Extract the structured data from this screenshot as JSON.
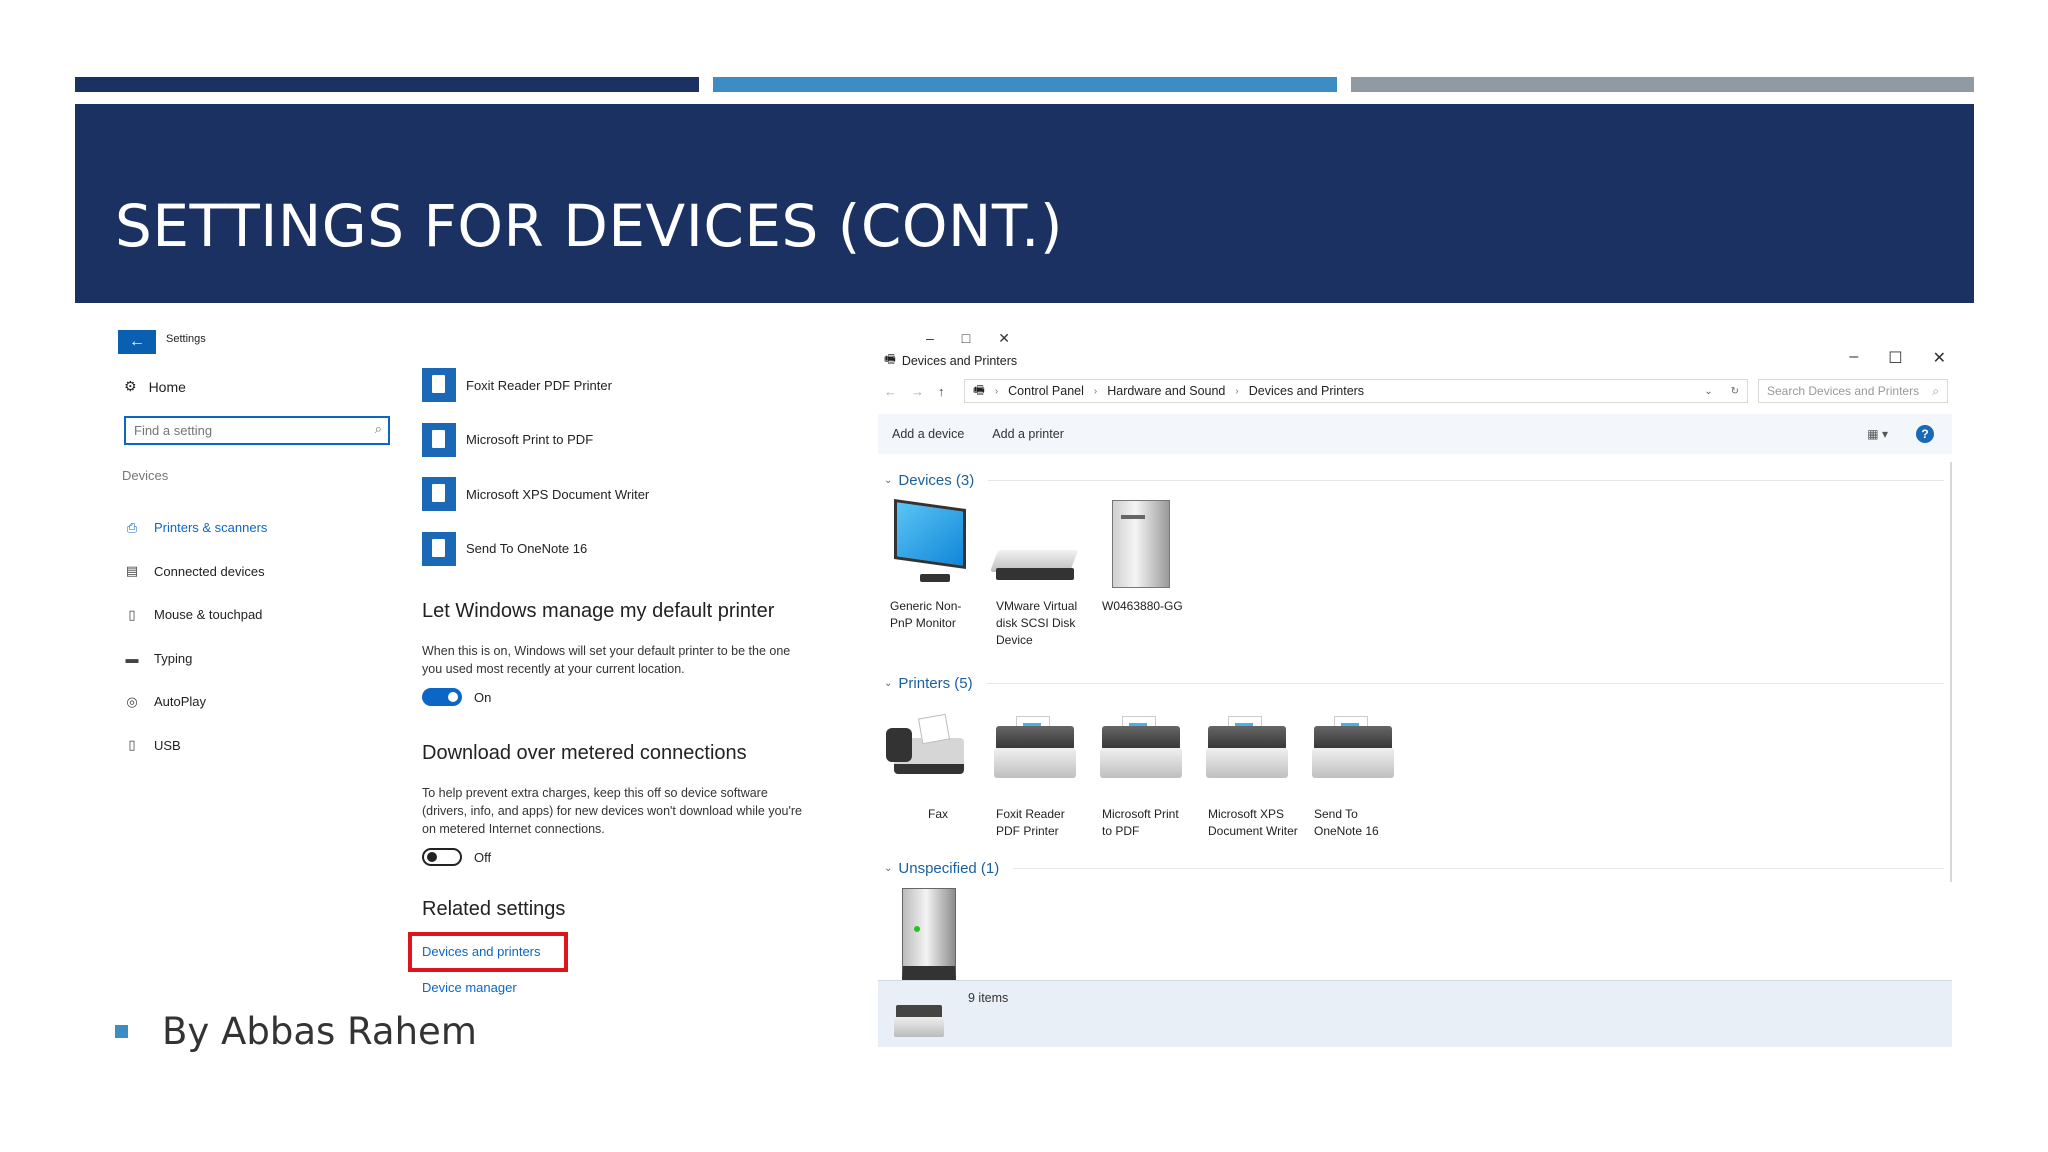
{
  "slide": {
    "title": "SETTINGS FOR DEVICES (CONT.)",
    "byline": "By Abbas Rahem",
    "colors": {
      "navy": "#1b3162",
      "blue": "#3d8cc4",
      "gray": "#8f9aa3",
      "highlight": "#e0141b"
    }
  },
  "settings": {
    "window_title": "Settings",
    "home_label": "Home",
    "search_placeholder": "Find a setting",
    "section_label": "Devices",
    "nav": [
      {
        "label": "Printers & scanners",
        "icon": "printer-icon",
        "active": true
      },
      {
        "label": "Connected devices",
        "icon": "devices-icon"
      },
      {
        "label": "Mouse & touchpad",
        "icon": "mouse-icon"
      },
      {
        "label": "Typing",
        "icon": "keyboard-icon"
      },
      {
        "label": "AutoPlay",
        "icon": "autoplay-icon"
      },
      {
        "label": "USB",
        "icon": "usb-icon"
      }
    ],
    "printers": [
      "Foxit Reader PDF Printer",
      "Microsoft Print to PDF",
      "Microsoft XPS Document Writer",
      "Send To OneNote 16"
    ],
    "default_printer": {
      "heading": "Let Windows manage my default printer",
      "desc": "When this is on, Windows will set your default printer to be the one you used most recently at your current location.",
      "state": "On"
    },
    "metered": {
      "heading": "Download over metered connections",
      "desc": "To help prevent extra charges, keep this off so device software (drivers, info, and apps) for new devices won't download while you're on metered Internet connections.",
      "state": "Off"
    },
    "related": {
      "heading": "Related settings",
      "links": [
        "Devices and printers",
        "Device manager"
      ]
    }
  },
  "devices_window": {
    "title": "Devices and Printers",
    "breadcrumb": [
      "Control Panel",
      "Hardware and Sound",
      "Devices and Printers"
    ],
    "search_placeholder": "Search Devices and Printers",
    "toolbar": [
      "Add a device",
      "Add a printer"
    ],
    "groups": {
      "devices": {
        "label": "Devices (3)",
        "items": [
          "Generic Non-PnP Monitor",
          "VMware Virtual disk SCSI Disk Device",
          "W0463880-GG"
        ]
      },
      "printers": {
        "label": "Printers (5)",
        "items": [
          "Fax",
          "Foxit Reader PDF Printer",
          "Microsoft Print to PDF",
          "Microsoft XPS Document Writer",
          "Send To OneNote 16"
        ]
      },
      "unspecified": {
        "label": "Unspecified (1)"
      }
    },
    "status": "9 items"
  }
}
